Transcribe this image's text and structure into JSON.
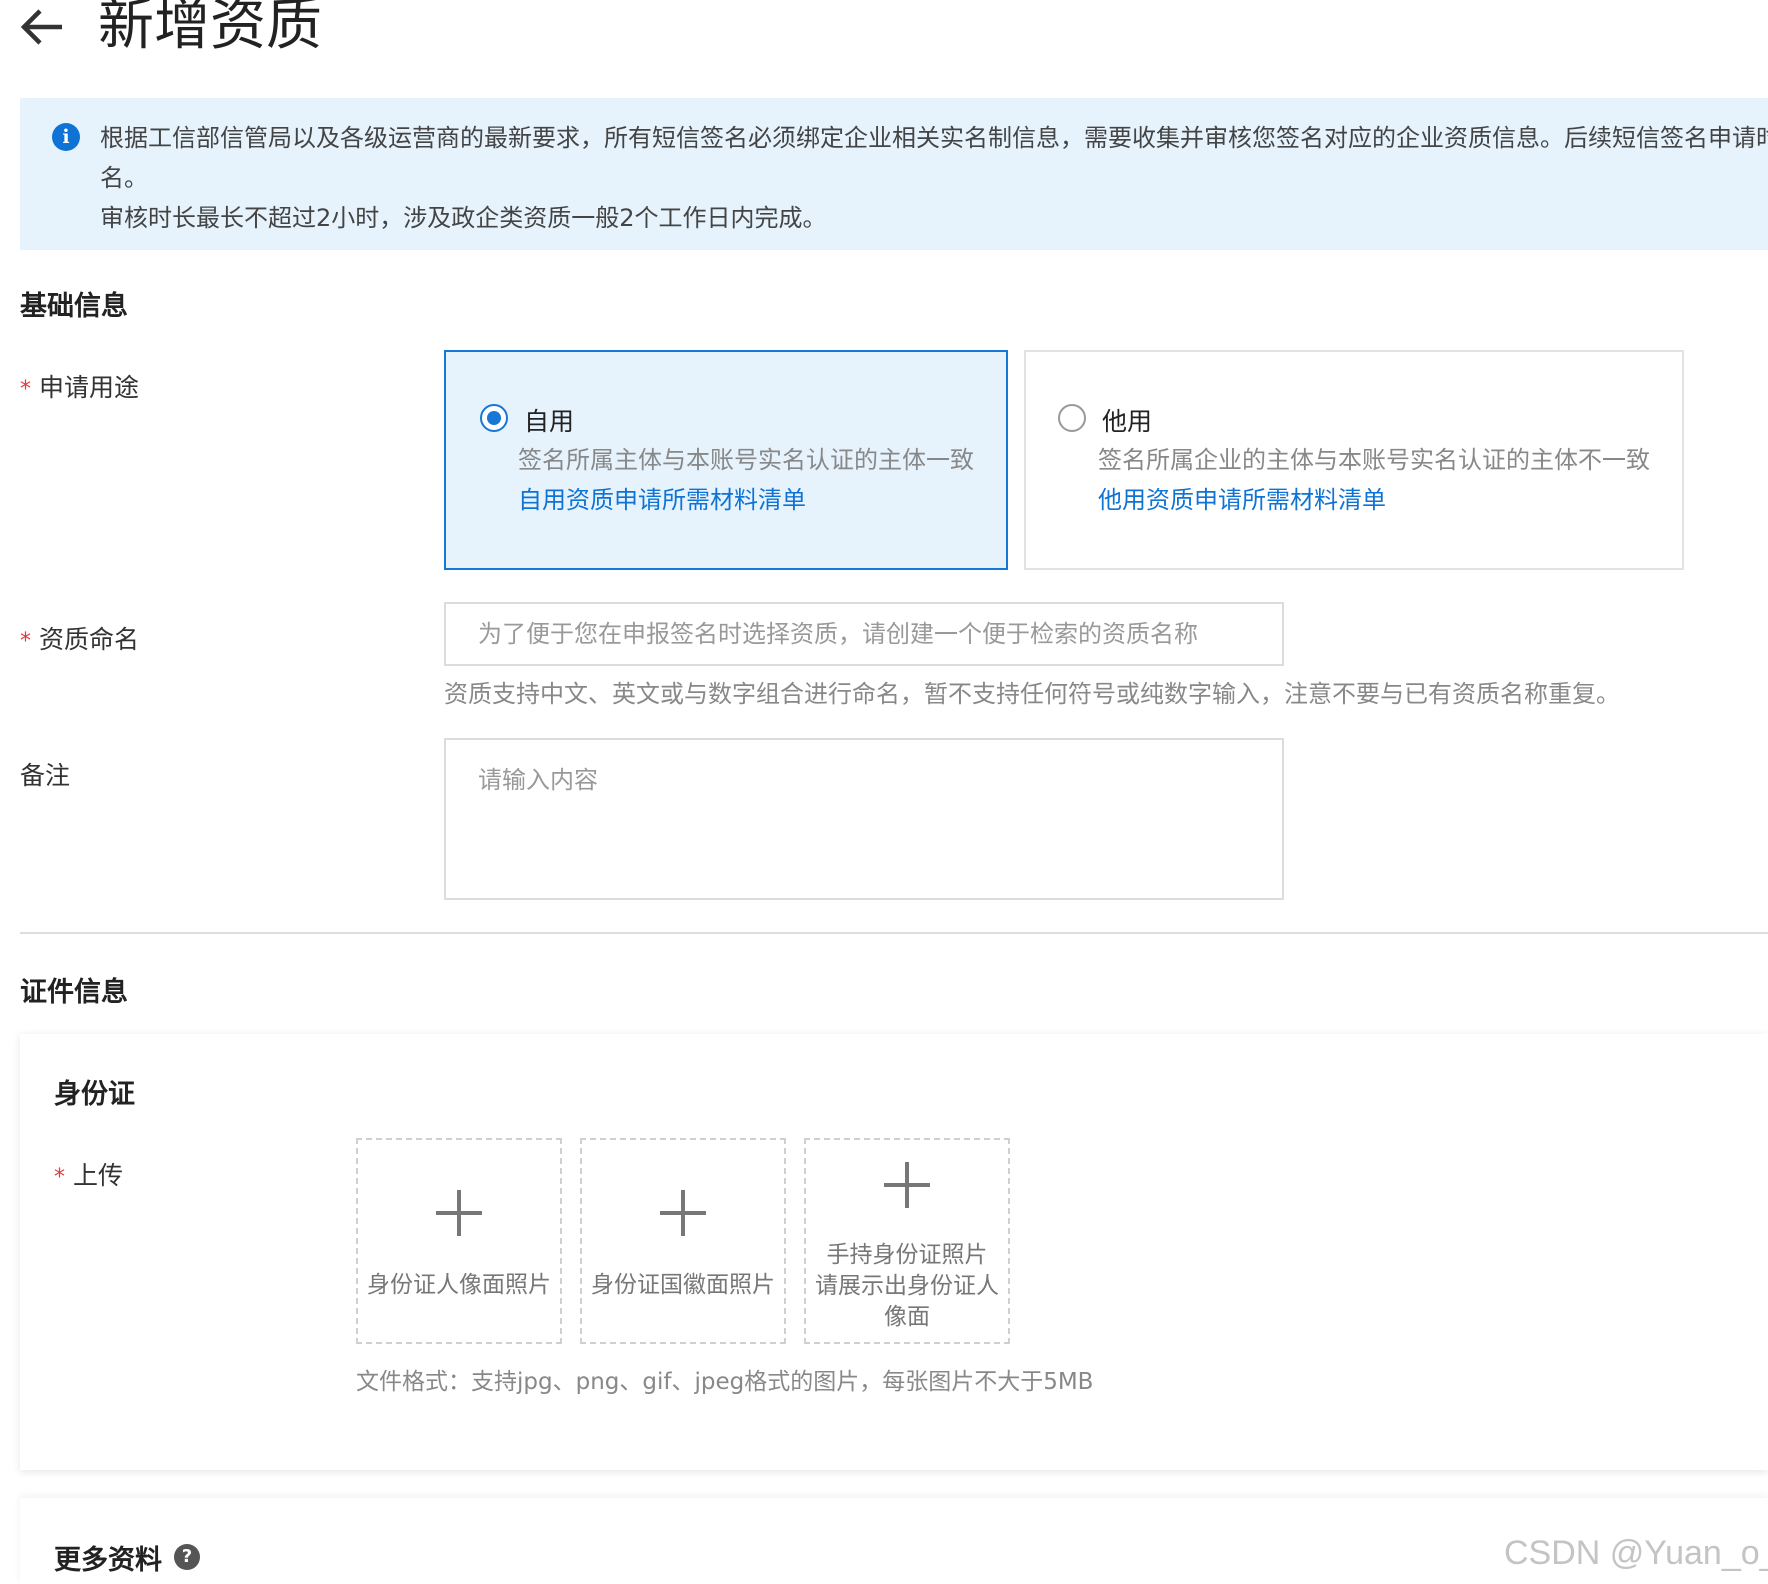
{
  "header": {
    "title": "新增资质"
  },
  "notice": {
    "line1": "根据工信部信管局以及各级运营商的最新要求，所有短信签名必须绑定企业相关实名制信息，需要收集并审核您签名对应的企业资质信息。后续短信签名申请时",
    "line2": "名。",
    "line3": "审核时长最长不超过2小时，涉及政企类资质一般2个工作日内完成。"
  },
  "basic": {
    "heading": "基础信息",
    "purpose": {
      "label": "申请用途",
      "required_mark": "*",
      "options": [
        {
          "title": "自用",
          "desc": "签名所属主体与本账号实名认证的主体一致",
          "link": "自用资质申请所需材料清单",
          "selected": true
        },
        {
          "title": "他用",
          "desc": "签名所属企业的主体与本账号实名认证的主体不一致",
          "link": "他用资质申请所需材料清单",
          "selected": false
        }
      ]
    },
    "name": {
      "label": "资质命名",
      "required_mark": "*",
      "placeholder": "为了便于您在申报签名时选择资质，请创建一个便于检索的资质名称",
      "hint": "资质支持中文、英文或与数字组合进行命名，暂不支持任何符号或纯数字输入，注意不要与已有资质名称重复。"
    },
    "remark": {
      "label": "备注",
      "placeholder": "请输入内容"
    }
  },
  "cert": {
    "heading": "证件信息",
    "idcard": {
      "title": "身份证",
      "upload_label": "上传",
      "required_mark": "*",
      "slots": [
        {
          "lines": [
            "身份证人像面照片"
          ]
        },
        {
          "lines": [
            "身份证国徽面照片"
          ]
        },
        {
          "lines": [
            "手持身份证照片",
            "请展示出身份证人",
            "像面"
          ]
        }
      ],
      "file_hint": "文件格式：支持jpg、png、gif、jpeg格式的图片，每张图片不大于5MB"
    }
  },
  "more": {
    "title": "更多资料",
    "help_glyph": "?"
  },
  "watermark": "CSDN @Yuan_o_",
  "colors": {
    "accent": "#1677d6",
    "notice_bg": "#e6f3fd",
    "required": "#e4393c"
  }
}
